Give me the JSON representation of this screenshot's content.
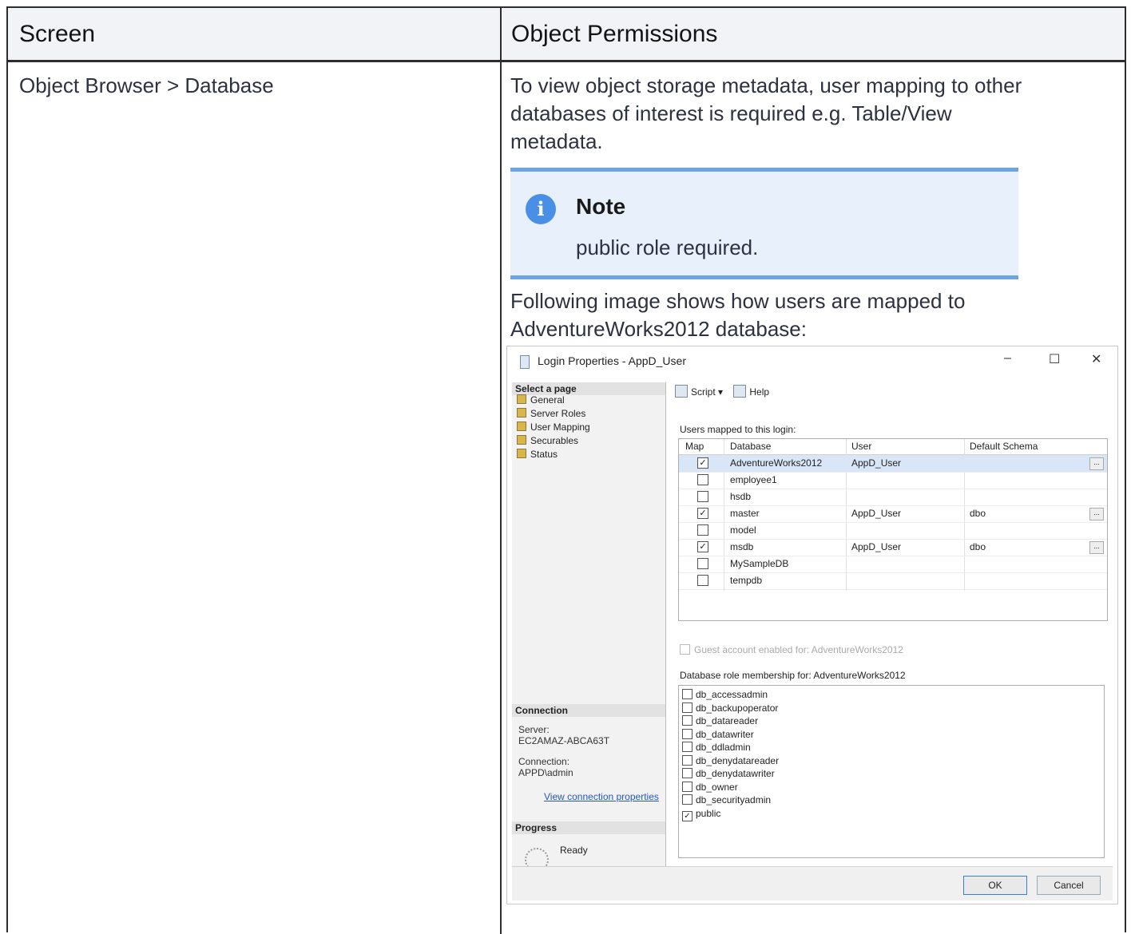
{
  "table": {
    "headers": [
      "Screen",
      "Object Permissions"
    ],
    "screen": "Object Browser > Database",
    "intro_lines": [
      "To view object storage metadata, user mapping to other",
      "databases of interest is required e.g. Table/View",
      "metadata."
    ],
    "note_title": "Note",
    "note_text": "public role required.",
    "following_lines": [
      "Following image shows how users are mapped to",
      "AdventureWorks2012 database:"
    ]
  },
  "dialog": {
    "title": "Login Properties - AppD_User",
    "win_buttons": [
      "–",
      "☐",
      "✕"
    ],
    "select_page": "Select a page",
    "pages": [
      "General",
      "Server Roles",
      "User Mapping",
      "Securables",
      "Status"
    ],
    "toolbar": {
      "script": "Script",
      "help": "Help"
    },
    "users_label": "Users mapped to this login:",
    "columns": [
      "Map",
      "Database",
      "User",
      "Default Schema"
    ],
    "rows": [
      {
        "checked": true,
        "database": "AdventureWorks2012",
        "user": "AppD_User",
        "schema": "",
        "button": true,
        "selected": true
      },
      {
        "checked": false,
        "database": "employee1",
        "user": "",
        "schema": "",
        "button": false,
        "selected": false
      },
      {
        "checked": false,
        "database": "hsdb",
        "user": "",
        "schema": "",
        "button": false,
        "selected": false
      },
      {
        "checked": true,
        "database": "master",
        "user": "AppD_User",
        "schema": "dbo",
        "button": true,
        "selected": false
      },
      {
        "checked": false,
        "database": "model",
        "user": "",
        "schema": "",
        "button": false,
        "selected": false
      },
      {
        "checked": true,
        "database": "msdb",
        "user": "AppD_User",
        "schema": "dbo",
        "button": true,
        "selected": false
      },
      {
        "checked": false,
        "database": "MySampleDB",
        "user": "",
        "schema": "",
        "button": false,
        "selected": false
      },
      {
        "checked": false,
        "database": "tempdb",
        "user": "",
        "schema": "",
        "button": false,
        "selected": false
      }
    ],
    "guest_label": "Guest account enabled for: AdventureWorks2012",
    "role_label": "Database role membership for: AdventureWorks2012",
    "roles": [
      {
        "name": "db_accessadmin",
        "checked": false
      },
      {
        "name": "db_backupoperator",
        "checked": false
      },
      {
        "name": "db_datareader",
        "checked": false
      },
      {
        "name": "db_datawriter",
        "checked": false
      },
      {
        "name": "db_ddladmin",
        "checked": false
      },
      {
        "name": "db_denydatareader",
        "checked": false
      },
      {
        "name": "db_denydatawriter",
        "checked": false
      },
      {
        "name": "db_owner",
        "checked": false
      },
      {
        "name": "db_securityadmin",
        "checked": false
      },
      {
        "name": "public",
        "checked": true
      }
    ],
    "connection": {
      "heading": "Connection",
      "server_label": "Server:",
      "server": "EC2AMAZ-ABCA63T",
      "connection_label": "Connection:",
      "connection": "APPD\\admin",
      "link": "View connection properties"
    },
    "progress": {
      "heading": "Progress",
      "status": "Ready"
    },
    "ok": "OK",
    "cancel": "Cancel"
  }
}
